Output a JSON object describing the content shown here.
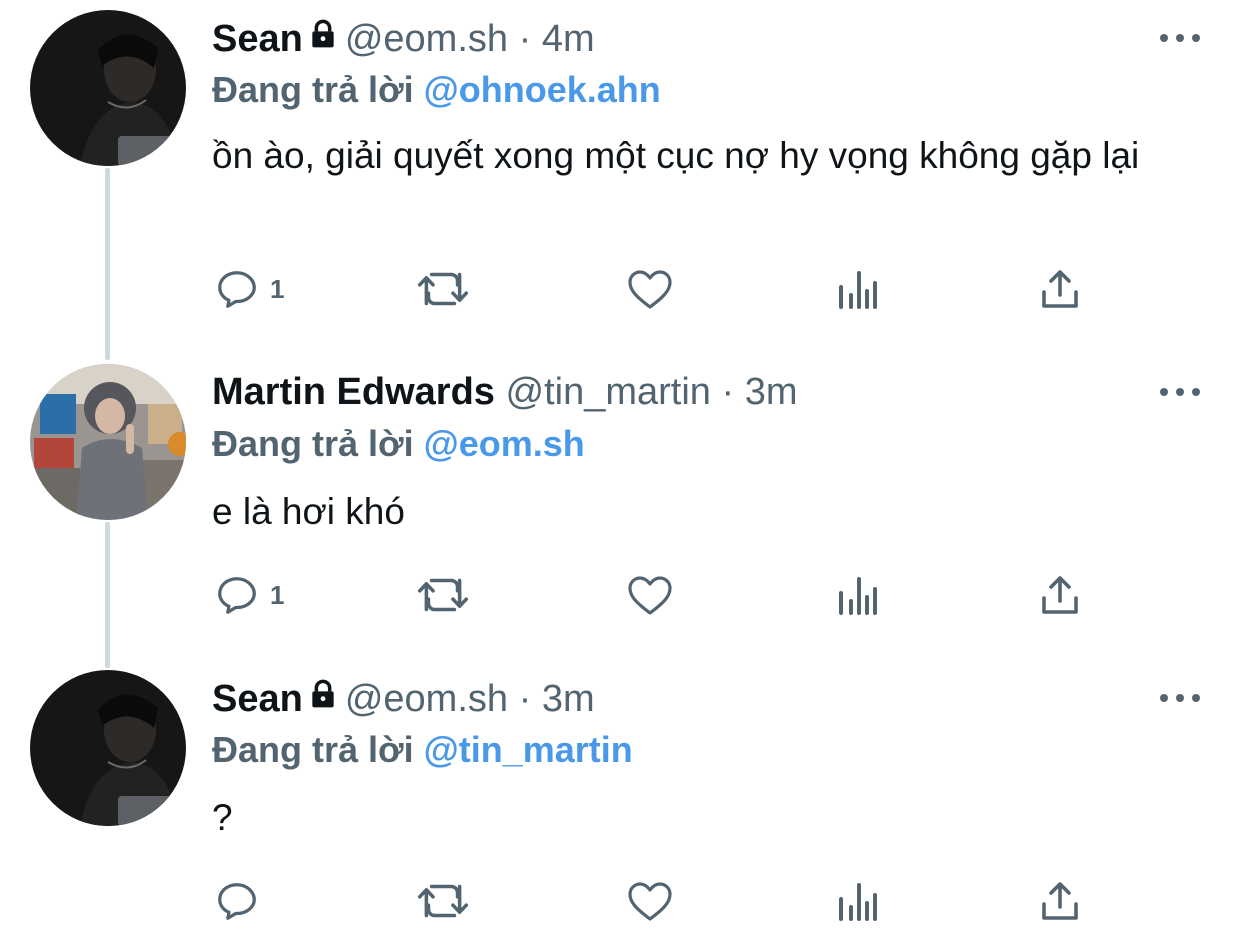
{
  "colors": {
    "mention": "#4a99e9",
    "secondary_text": "#536471",
    "thread_line": "#cfd9de"
  },
  "tweets": [
    {
      "name": "Sean",
      "locked": true,
      "handle": "@eom.sh",
      "separator": "·",
      "time": "4m",
      "reply_prefix": "Đang trả lời",
      "reply_to": "@ohnoek.ahn",
      "text": "ồn ào, giải quyết xong một cục nợ hy vọng không gặp lại",
      "reply_count": "1",
      "icons": [
        "reply-icon",
        "retweet-icon",
        "like-icon",
        "analytics-icon",
        "share-icon",
        "more-icon",
        "lock-icon"
      ]
    },
    {
      "name": "Martin Edwards",
      "locked": false,
      "handle": "@tin_martin",
      "separator": "·",
      "time": "3m",
      "reply_prefix": "Đang trả lời",
      "reply_to": "@eom.sh",
      "text": "e là hơi khó",
      "reply_count": "1",
      "icons": [
        "reply-icon",
        "retweet-icon",
        "like-icon",
        "analytics-icon",
        "share-icon",
        "more-icon"
      ]
    },
    {
      "name": "Sean",
      "locked": true,
      "handle": "@eom.sh",
      "separator": "·",
      "time": "3m",
      "reply_prefix": "Đang trả lời",
      "reply_to": "@tin_martin",
      "text": "?",
      "reply_count": "",
      "icons": [
        "reply-icon",
        "retweet-icon",
        "like-icon",
        "analytics-icon",
        "share-icon",
        "more-icon",
        "lock-icon"
      ]
    }
  ]
}
